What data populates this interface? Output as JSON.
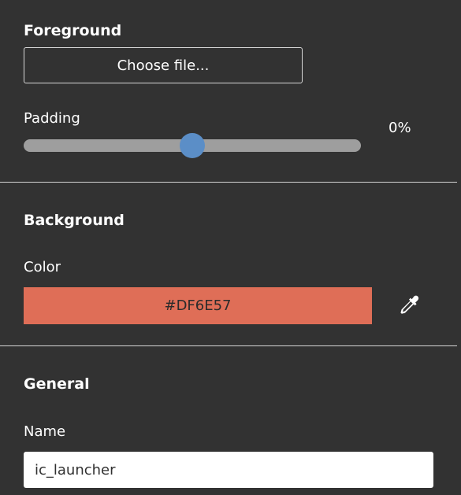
{
  "foreground": {
    "heading": "Foreground",
    "choose_file_label": "Choose file..."
  },
  "padding": {
    "label": "Padding",
    "value_text": "0%",
    "slider_position": 0.5
  },
  "background": {
    "heading": "Background",
    "color_label": "Color",
    "color_value": "#DF6E57",
    "eyedropper_icon": "eyedropper-icon"
  },
  "general": {
    "heading": "General",
    "name_label": "Name",
    "name_value": "ic_launcher"
  },
  "colors": {
    "panel_background": "#323232",
    "divider": "#d6d6d6",
    "slider_track": "#9e9e9e",
    "slider_thumb": "#5b8ec7",
    "swatch": "#DF6E57"
  }
}
